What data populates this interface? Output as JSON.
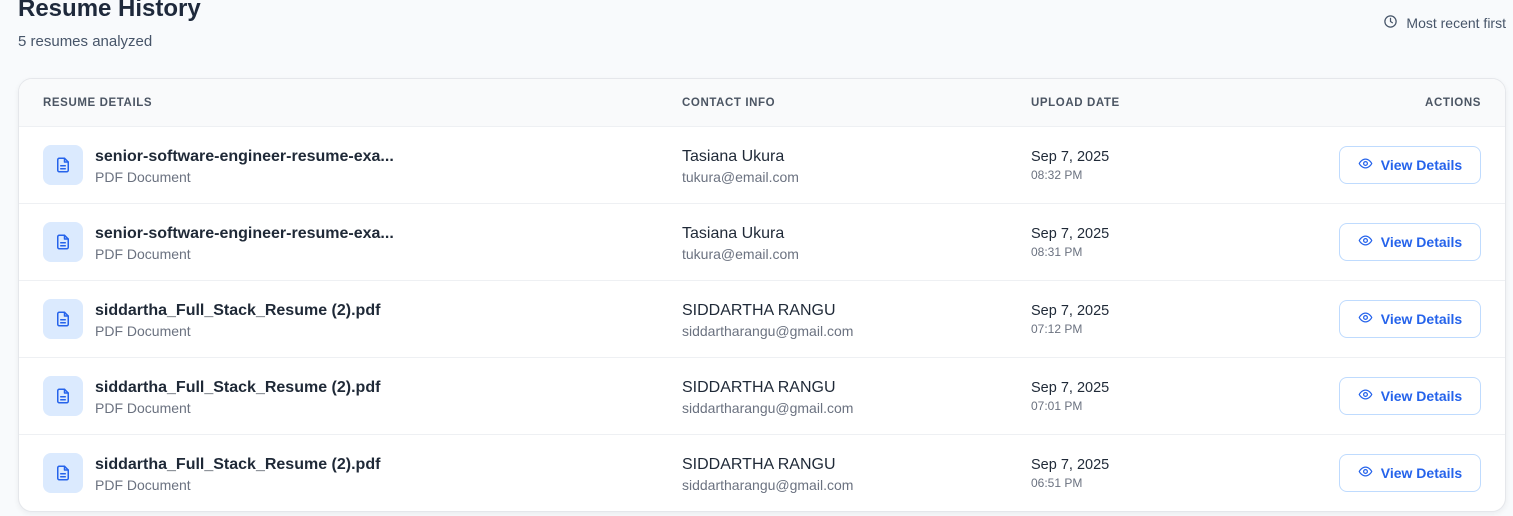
{
  "header": {
    "title": "Resume History",
    "subtitle": "5 resumes analyzed",
    "sort_label": "Most recent first",
    "sort_icon": "clock-icon"
  },
  "table": {
    "columns": [
      "RESUME DETAILS",
      "CONTACT INFO",
      "UPLOAD DATE",
      "ACTIONS"
    ],
    "rows": [
      {
        "file_name": "senior-software-engineer-resume-exa...",
        "file_type": "PDF Document",
        "contact_name": "Tasiana Ukura",
        "contact_email": "tukura@email.com",
        "date": "Sep 7, 2025",
        "time": "08:32 PM",
        "action": "View Details"
      },
      {
        "file_name": "senior-software-engineer-resume-exa...",
        "file_type": "PDF Document",
        "contact_name": "Tasiana Ukura",
        "contact_email": "tukura@email.com",
        "date": "Sep 7, 2025",
        "time": "08:31 PM",
        "action": "View Details"
      },
      {
        "file_name": "siddartha_Full_Stack_Resume (2).pdf",
        "file_type": "PDF Document",
        "contact_name": "SIDDARTHA RANGU",
        "contact_email": "siddartharangu@gmail.com",
        "date": "Sep 7, 2025",
        "time": "07:12 PM",
        "action": "View Details"
      },
      {
        "file_name": "siddartha_Full_Stack_Resume (2).pdf",
        "file_type": "PDF Document",
        "contact_name": "SIDDARTHA RANGU",
        "contact_email": "siddartharangu@gmail.com",
        "date": "Sep 7, 2025",
        "time": "07:01 PM",
        "action": "View Details"
      },
      {
        "file_name": "siddartha_Full_Stack_Resume (2).pdf",
        "file_type": "PDF Document",
        "contact_name": "SIDDARTHA RANGU",
        "contact_email": "siddartharangu@gmail.com",
        "date": "Sep 7, 2025",
        "time": "06:51 PM",
        "action": "View Details"
      }
    ]
  },
  "icons": {
    "row_icon": "document-icon",
    "action_icon": "eye-icon"
  },
  "colors": {
    "accent": "#2563eb",
    "icon_bg": "#dbeafe",
    "button_border": "#bfdbfe"
  }
}
